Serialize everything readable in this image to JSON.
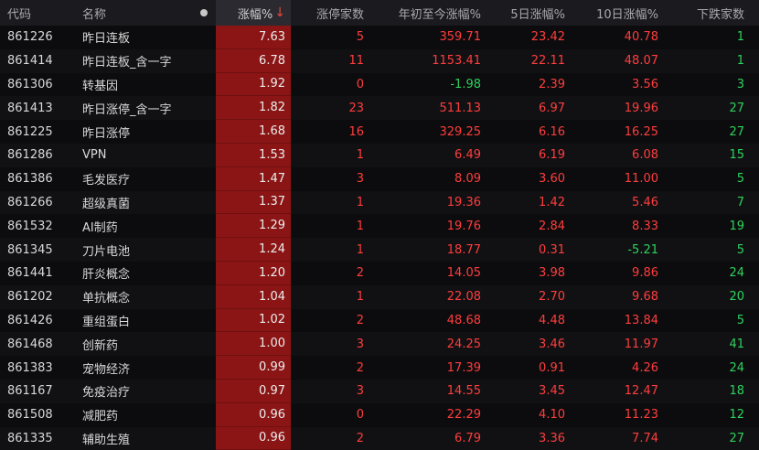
{
  "columns": {
    "code": "代码",
    "name": "名称",
    "change_pct": "涨幅%",
    "sort_arrow": "↓",
    "limit_up_count": "涨停家数",
    "ytd_change": "年初至今涨幅%",
    "d5_change": "5日涨幅%",
    "d10_change": "10日涨幅%",
    "decline_count": "下跌家数"
  },
  "colors": {
    "up": "#ff3d3d",
    "down": "#2fd15d",
    "highlight": "#8b1515"
  },
  "rows": [
    {
      "code": "861226",
      "name": "昨日连板",
      "pct": "7.63",
      "limit": "5",
      "limit_c": "red",
      "ytd": "359.71",
      "ytd_c": "red",
      "d5": "23.42",
      "d5_c": "red",
      "d10": "40.78",
      "d10_c": "red",
      "fall": "1"
    },
    {
      "code": "861414",
      "name": "昨日连板_含一字",
      "pct": "6.78",
      "limit": "11",
      "limit_c": "red",
      "ytd": "1153.41",
      "ytd_c": "red",
      "d5": "22.11",
      "d5_c": "red",
      "d10": "48.07",
      "d10_c": "red",
      "fall": "1"
    },
    {
      "code": "861306",
      "name": "转基因",
      "pct": "1.92",
      "limit": "0",
      "limit_c": "red",
      "ytd": "-1.98",
      "ytd_c": "green",
      "d5": "2.39",
      "d5_c": "red",
      "d10": "3.56",
      "d10_c": "red",
      "fall": "3"
    },
    {
      "code": "861413",
      "name": "昨日涨停_含一字",
      "pct": "1.82",
      "limit": "23",
      "limit_c": "red",
      "ytd": "511.13",
      "ytd_c": "red",
      "d5": "6.97",
      "d5_c": "red",
      "d10": "19.96",
      "d10_c": "red",
      "fall": "27"
    },
    {
      "code": "861225",
      "name": "昨日涨停",
      "pct": "1.68",
      "limit": "16",
      "limit_c": "red",
      "ytd": "329.25",
      "ytd_c": "red",
      "d5": "6.16",
      "d5_c": "red",
      "d10": "16.25",
      "d10_c": "red",
      "fall": "27"
    },
    {
      "code": "861286",
      "name": "VPN",
      "pct": "1.53",
      "limit": "1",
      "limit_c": "red",
      "ytd": "6.49",
      "ytd_c": "red",
      "d5": "6.19",
      "d5_c": "red",
      "d10": "6.08",
      "d10_c": "red",
      "fall": "15"
    },
    {
      "code": "861386",
      "name": "毛发医疗",
      "pct": "1.47",
      "limit": "3",
      "limit_c": "red",
      "ytd": "8.09",
      "ytd_c": "red",
      "d5": "3.60",
      "d5_c": "red",
      "d10": "11.00",
      "d10_c": "red",
      "fall": "5"
    },
    {
      "code": "861266",
      "name": "超级真菌",
      "pct": "1.37",
      "limit": "1",
      "limit_c": "red",
      "ytd": "19.36",
      "ytd_c": "red",
      "d5": "1.42",
      "d5_c": "red",
      "d10": "5.46",
      "d10_c": "red",
      "fall": "7"
    },
    {
      "code": "861532",
      "name": "AI制药",
      "pct": "1.29",
      "limit": "1",
      "limit_c": "red",
      "ytd": "19.76",
      "ytd_c": "red",
      "d5": "2.84",
      "d5_c": "red",
      "d10": "8.33",
      "d10_c": "red",
      "fall": "19"
    },
    {
      "code": "861345",
      "name": "刀片电池",
      "pct": "1.24",
      "limit": "1",
      "limit_c": "red",
      "ytd": "18.77",
      "ytd_c": "red",
      "d5": "0.31",
      "d5_c": "red",
      "d10": "-5.21",
      "d10_c": "green",
      "fall": "5"
    },
    {
      "code": "861441",
      "name": "肝炎概念",
      "pct": "1.20",
      "limit": "2",
      "limit_c": "red",
      "ytd": "14.05",
      "ytd_c": "red",
      "d5": "3.98",
      "d5_c": "red",
      "d10": "9.86",
      "d10_c": "red",
      "fall": "24"
    },
    {
      "code": "861202",
      "name": "单抗概念",
      "pct": "1.04",
      "limit": "1",
      "limit_c": "red",
      "ytd": "22.08",
      "ytd_c": "red",
      "d5": "2.70",
      "d5_c": "red",
      "d10": "9.68",
      "d10_c": "red",
      "fall": "20"
    },
    {
      "code": "861426",
      "name": "重组蛋白",
      "pct": "1.02",
      "limit": "2",
      "limit_c": "red",
      "ytd": "48.68",
      "ytd_c": "red",
      "d5": "4.48",
      "d5_c": "red",
      "d10": "13.84",
      "d10_c": "red",
      "fall": "5"
    },
    {
      "code": "861468",
      "name": "创新药",
      "pct": "1.00",
      "limit": "3",
      "limit_c": "red",
      "ytd": "24.25",
      "ytd_c": "red",
      "d5": "3.46",
      "d5_c": "red",
      "d10": "11.97",
      "d10_c": "red",
      "fall": "41"
    },
    {
      "code": "861383",
      "name": "宠物经济",
      "pct": "0.99",
      "limit": "2",
      "limit_c": "red",
      "ytd": "17.39",
      "ytd_c": "red",
      "d5": "0.91",
      "d5_c": "red",
      "d10": "4.26",
      "d10_c": "red",
      "fall": "24"
    },
    {
      "code": "861167",
      "name": "免疫治疗",
      "pct": "0.97",
      "limit": "3",
      "limit_c": "red",
      "ytd": "14.55",
      "ytd_c": "red",
      "d5": "3.45",
      "d5_c": "red",
      "d10": "12.47",
      "d10_c": "red",
      "fall": "18"
    },
    {
      "code": "861508",
      "name": "减肥药",
      "pct": "0.96",
      "limit": "0",
      "limit_c": "red",
      "ytd": "22.29",
      "ytd_c": "red",
      "d5": "4.10",
      "d5_c": "red",
      "d10": "11.23",
      "d10_c": "red",
      "fall": "12"
    },
    {
      "code": "861335",
      "name": "辅助生殖",
      "pct": "0.96",
      "limit": "2",
      "limit_c": "red",
      "ytd": "6.79",
      "ytd_c": "red",
      "d5": "3.36",
      "d5_c": "red",
      "d10": "7.74",
      "d10_c": "red",
      "fall": "27"
    }
  ]
}
